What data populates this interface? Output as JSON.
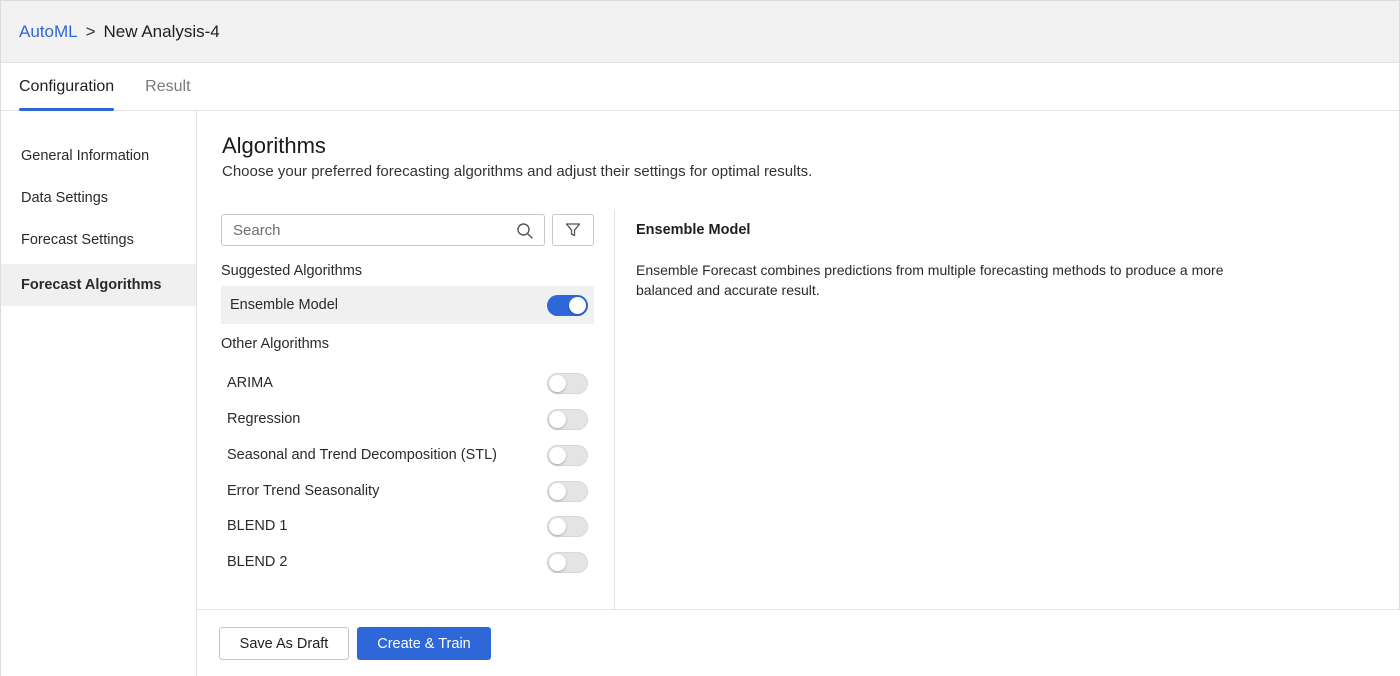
{
  "breadcrumb": {
    "root": "AutoML",
    "separator": ">",
    "current": "New Analysis-4"
  },
  "tabs": [
    {
      "label": "Configuration",
      "active": true
    },
    {
      "label": "Result",
      "active": false
    }
  ],
  "sidebar": {
    "items": [
      {
        "label": "General Information",
        "active": false
      },
      {
        "label": "Data Settings",
        "active": false
      },
      {
        "label": "Forecast Settings",
        "active": false
      },
      {
        "label": "Forecast Algorithms",
        "active": true
      }
    ]
  },
  "main": {
    "title": "Algorithms",
    "subtitle": "Choose your preferred forecasting algorithms and adjust their settings for optimal results."
  },
  "search": {
    "placeholder": "Search",
    "value": ""
  },
  "suggested": {
    "label": "Suggested Algorithms",
    "items": [
      {
        "label": "Ensemble Model",
        "enabled": true
      }
    ]
  },
  "other": {
    "label": "Other Algorithms",
    "items": [
      {
        "label": "ARIMA",
        "enabled": false
      },
      {
        "label": "Regression",
        "enabled": false
      },
      {
        "label": "Seasonal and Trend Decomposition (STL)",
        "enabled": false
      },
      {
        "label": "Error Trend Seasonality",
        "enabled": false
      },
      {
        "label": "BLEND 1",
        "enabled": false
      },
      {
        "label": "BLEND 2",
        "enabled": false
      }
    ]
  },
  "detail": {
    "title": "Ensemble Model",
    "description": "Ensemble Forecast combines predictions from multiple forecasting methods to produce a more balanced and accurate result."
  },
  "footer": {
    "draft_label": "Save As Draft",
    "create_label": "Create & Train"
  },
  "colors": {
    "accent": "#2d67d8",
    "toggle_off": "#e4e4e4",
    "active_bg": "#f0f0f0"
  },
  "icons": {
    "search": "search-icon",
    "filter": "filter-icon"
  }
}
